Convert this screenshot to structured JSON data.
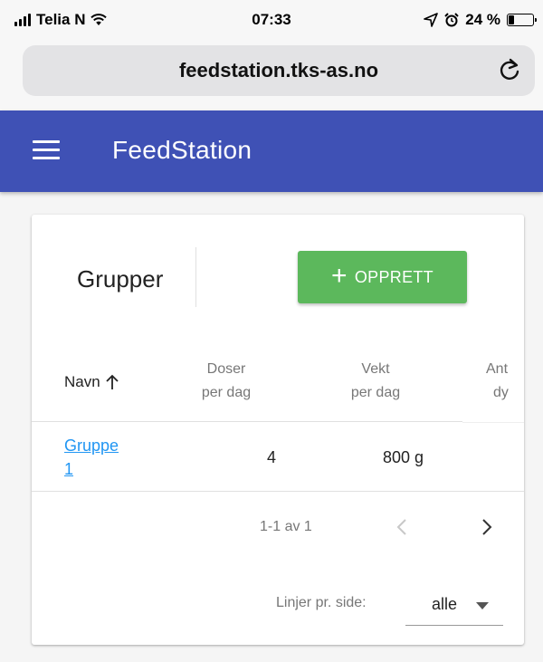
{
  "status_bar": {
    "carrier": "Telia N",
    "time": "07:33",
    "battery": "24 %"
  },
  "browser": {
    "url": "feedstation.tks-as.no"
  },
  "app_bar": {
    "title": "FeedStation",
    "color": "#3f51b5"
  },
  "card": {
    "title": "Grupper",
    "create_label": "OPPRETT",
    "create_color": "#5cb85c"
  },
  "table": {
    "headers": {
      "name": "Navn",
      "doses_line1": "Doser",
      "doses_line2": "per dag",
      "weight_line1": "Vekt",
      "weight_line2": "per dag",
      "count_line1": "Ant",
      "count_line2": "dy"
    },
    "rows": [
      {
        "name_line1": "Gruppe",
        "name_line2": "1",
        "doses": "4",
        "weight": "800 g"
      }
    ]
  },
  "pagination": {
    "info": "1-1 av 1",
    "rows_per_page_label": "Linjer pr. side:",
    "rows_per_page_value": "alle"
  }
}
